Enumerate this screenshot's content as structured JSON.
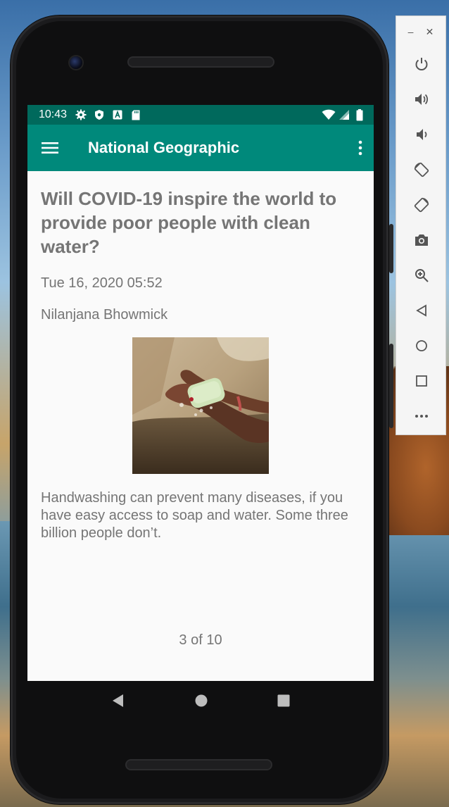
{
  "status_bar": {
    "time": "10:43",
    "left_icons": [
      "settings-icon",
      "shield-icon",
      "a-icon",
      "sd-card-icon"
    ],
    "right_icons": [
      "wifi-icon",
      "signal-icon",
      "battery-icon"
    ]
  },
  "app_bar": {
    "title": "National Geographic",
    "menu_icon": "hamburger-icon",
    "overflow_icon": "more-vert-icon"
  },
  "article": {
    "headline": "Will COVID-19 inspire the world to provide poor people with clean water?",
    "date": "Tue 16, 2020 05:52",
    "author": "Nilanjana Bhowmick",
    "image": "hands-washing-with-soap-photo",
    "description": "Handwashing can prevent many diseases, if you have easy access to soap and water. Some three billion people don’t.",
    "pager": "3 of 10"
  },
  "nav_bar": [
    "back-icon",
    "home-icon",
    "recents-icon"
  ],
  "emulator_panel": {
    "window_controls": [
      "minimize",
      "close"
    ],
    "buttons": [
      "power-icon",
      "volume-up-icon",
      "volume-down-icon",
      "rotate-left-icon",
      "rotate-right-icon",
      "camera-icon",
      "zoom-icon",
      "back-icon",
      "home-icon",
      "overview-icon",
      "more-icon"
    ]
  },
  "colors": {
    "status_bar": "#00695c",
    "app_bar": "#00897b",
    "text_gray": "#757575",
    "screen_bg": "#fafafa"
  }
}
